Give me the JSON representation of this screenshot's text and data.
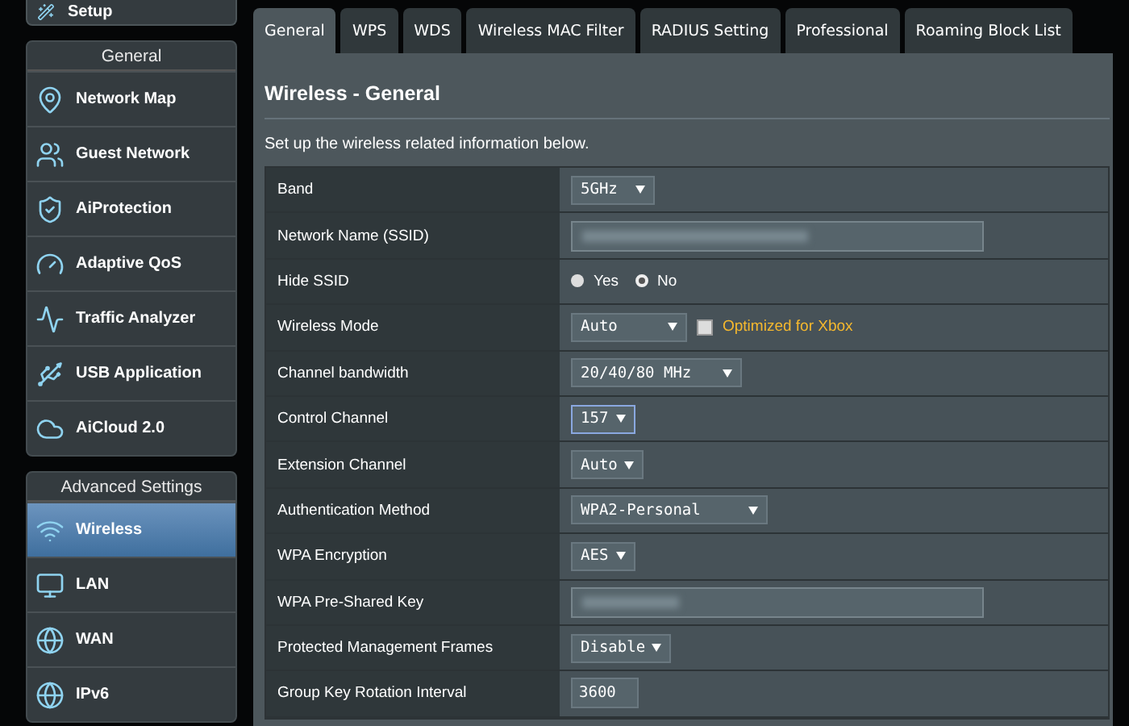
{
  "sidebar": {
    "top_item": {
      "label": "Setup"
    },
    "groups": [
      {
        "title": "General",
        "items": [
          {
            "label": "Network Map",
            "selected": false
          },
          {
            "label": "Guest Network",
            "selected": false
          },
          {
            "label": "AiProtection",
            "selected": false
          },
          {
            "label": "Adaptive QoS",
            "selected": false
          },
          {
            "label": "Traffic Analyzer",
            "selected": false
          },
          {
            "label": "USB Application",
            "selected": false
          },
          {
            "label": "AiCloud 2.0",
            "selected": false
          }
        ]
      },
      {
        "title": "Advanced Settings",
        "items": [
          {
            "label": "Wireless",
            "selected": true
          },
          {
            "label": "LAN",
            "selected": false
          },
          {
            "label": "WAN",
            "selected": false
          },
          {
            "label": "IPv6",
            "selected": false
          }
        ]
      }
    ]
  },
  "tabs": [
    {
      "label": "General",
      "selected": true
    },
    {
      "label": "WPS",
      "selected": false
    },
    {
      "label": "WDS",
      "selected": false
    },
    {
      "label": "Wireless MAC Filter",
      "selected": false
    },
    {
      "label": "RADIUS Setting",
      "selected": false
    },
    {
      "label": "Professional",
      "selected": false
    },
    {
      "label": "Roaming Block List",
      "selected": false
    }
  ],
  "panel": {
    "title": "Wireless - General",
    "description": "Set up the wireless related information below.",
    "rows": [
      {
        "label": "Band",
        "kind": "select",
        "value": "5GHz",
        "focused": false
      },
      {
        "label": "Network Name (SSID)",
        "kind": "redacted"
      },
      {
        "label": "Hide SSID",
        "kind": "radio",
        "options": [
          {
            "label": "Yes",
            "selected": false
          },
          {
            "label": "No",
            "selected": true
          }
        ]
      },
      {
        "label": "Wireless Mode",
        "kind": "select",
        "value": "Auto",
        "focused": false,
        "checkbox": {
          "label": "Optimized for Xbox",
          "checked": false
        }
      },
      {
        "label": "Channel bandwidth",
        "kind": "select",
        "value": "20/40/80 MHz",
        "focused": false
      },
      {
        "label": "Control Channel",
        "kind": "select",
        "value": "157",
        "focused": true
      },
      {
        "label": "Extension Channel",
        "kind": "select",
        "value": "Auto",
        "focused": false
      },
      {
        "label": "Authentication Method",
        "kind": "select",
        "value": "WPA2-Personal",
        "focused": false
      },
      {
        "label": "WPA Encryption",
        "kind": "select",
        "value": "AES",
        "focused": false
      },
      {
        "label": "WPA Pre-Shared Key",
        "kind": "redacted"
      },
      {
        "label": "Protected Management Frames",
        "kind": "select",
        "value": "Disable",
        "focused": false
      },
      {
        "label": "Group Key Rotation Interval",
        "kind": "input",
        "value": "3600"
      }
    ]
  }
}
